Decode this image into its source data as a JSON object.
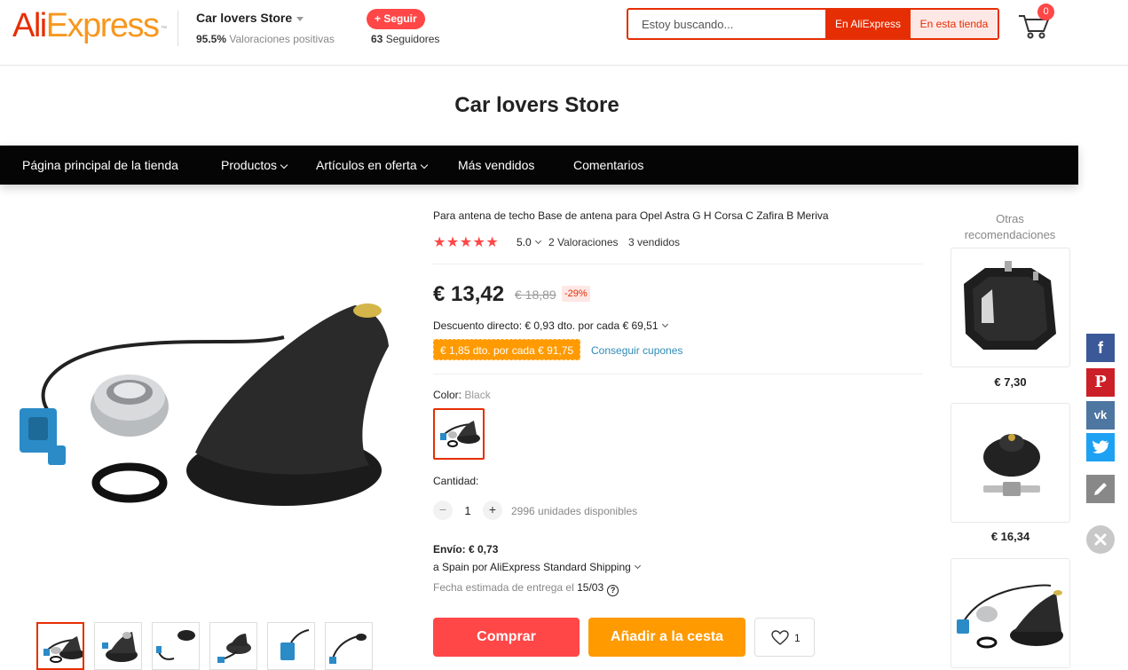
{
  "header": {
    "logo_ali": "Ali",
    "logo_express": "Express",
    "logo_tm": "™",
    "store_name": "Car lovers Store",
    "rating_value": "95.5%",
    "rating_label": "Valoraciones positivas",
    "follow_label": "+ Seguir",
    "followers_count": "63",
    "followers_label": "Seguidores",
    "search_placeholder": "Estoy buscando...",
    "search_aliexpress": "En AliExpress",
    "search_store": "En esta tienda",
    "cart_count": "0"
  },
  "store_banner": {
    "title": "Car lovers Store"
  },
  "nav": {
    "items": [
      {
        "label": "Página principal de la tienda"
      },
      {
        "label": "Productos"
      },
      {
        "label": "Artículos en oferta"
      },
      {
        "label": "Más vendidos"
      },
      {
        "label": "Comentarios"
      }
    ]
  },
  "product": {
    "title": "Para antena de techo Base de antena para Opel Astra G H Corsa C Zafira B Meriva",
    "stars": "★★★★★",
    "score": "5.0",
    "reviews": "2 Valoraciones",
    "sold": "3 vendidos",
    "price": "€ 13,42",
    "old_price": "€ 18,89",
    "discount": "-29%",
    "direct_discount": "Descuento directo: € 0,93 dto. por cada € 69,51",
    "coupon": "€ 1,85 dto. por cada € 91,75",
    "get_coupons": "Conseguir cupones",
    "color_label": "Color:",
    "color_value": "Black",
    "quantity_label": "Cantidad:",
    "quantity_minus": "−",
    "quantity_value": "1",
    "quantity_plus": "+",
    "available": "2996 unidades disponibles",
    "shipping": "Envío: € 0,73",
    "shipping_dest": "a Spain por AliExpress Standard Shipping",
    "delivery_label": "Fecha estimada de entrega el",
    "delivery_date": "15/03",
    "delivery_help": "?",
    "buy_label": "Comprar",
    "add_cart_label": "Añadir a la cesta",
    "wishlist_count": "1"
  },
  "recommendations": {
    "title": "Otras recomendaciones",
    "items": [
      {
        "price": "€ 7,30"
      },
      {
        "price": "€ 16,34"
      }
    ]
  },
  "social": {
    "facebook_glyph": "f",
    "pinterest_glyph": "P",
    "vk_glyph": "vk"
  },
  "colors": {
    "brand_red": "#e62e04",
    "buy_red": "#ff4747",
    "orange": "#ff9a00",
    "facebook": "#3b5998",
    "pinterest": "#cb2027",
    "vk": "#4d76a1",
    "twitter": "#1da1f2",
    "edit": "#888888"
  }
}
